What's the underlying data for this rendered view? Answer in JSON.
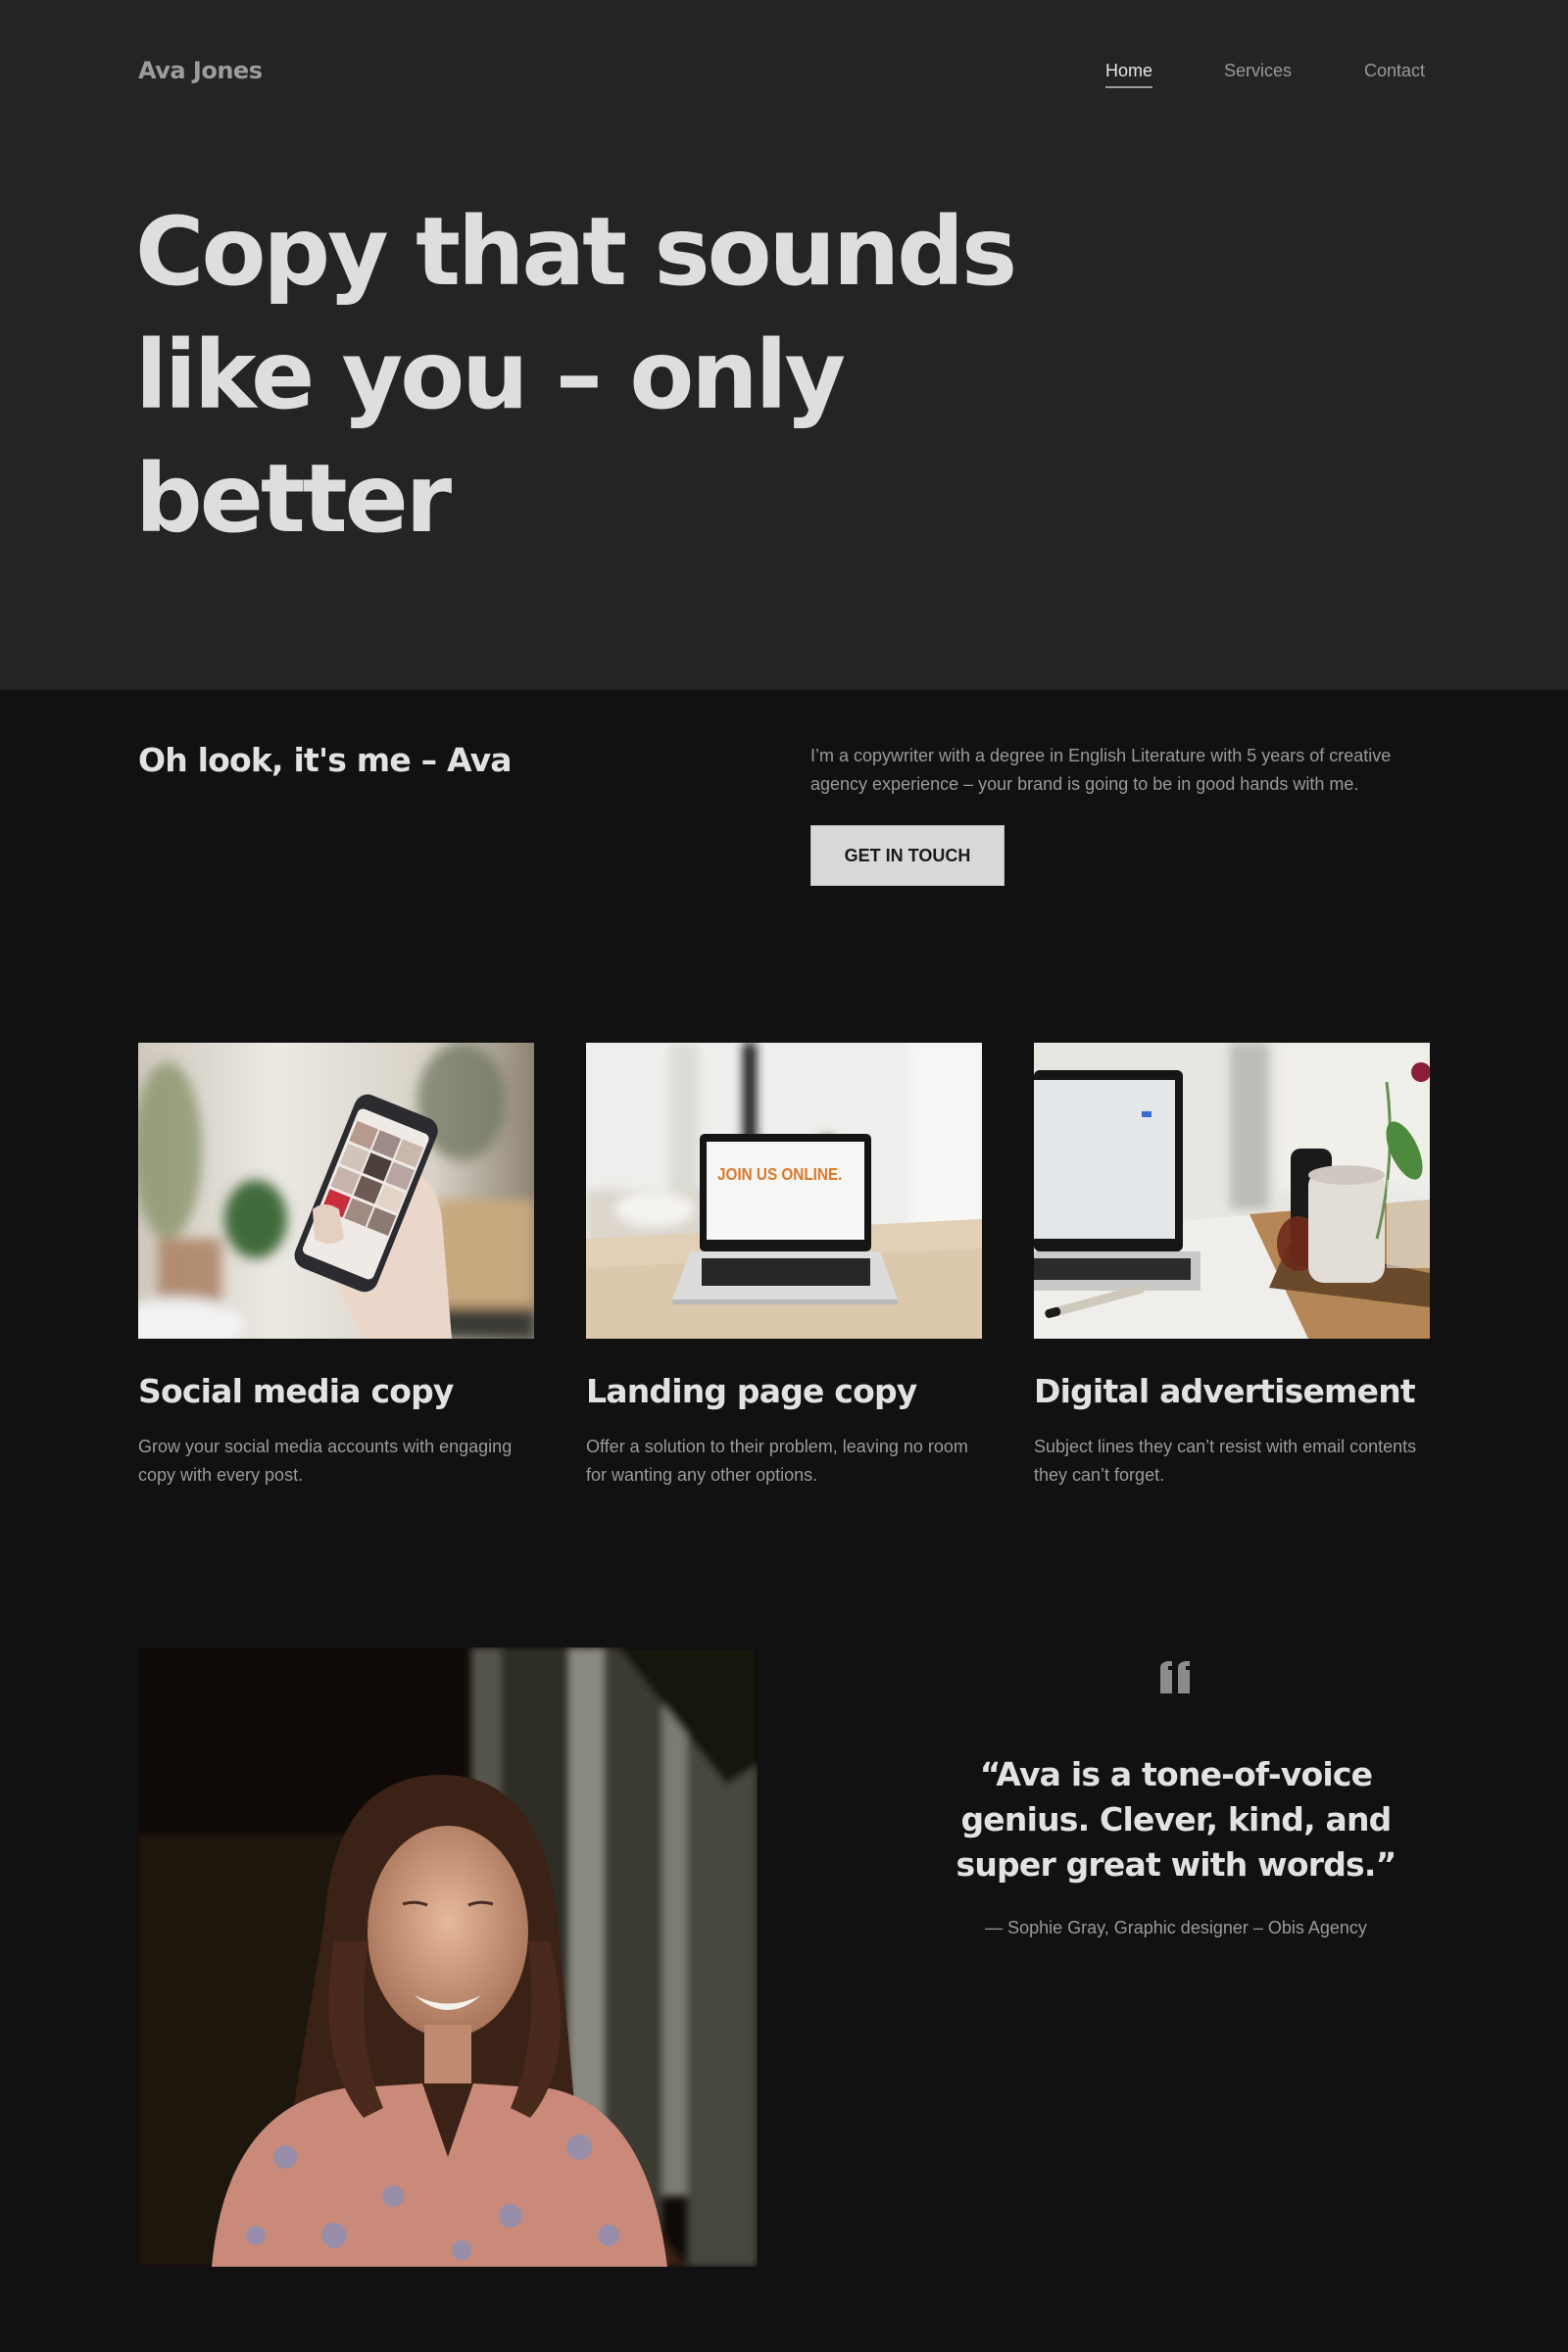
{
  "header": {
    "logo": "Ava Jones",
    "nav": [
      {
        "label": "Home",
        "active": true
      },
      {
        "label": "Services",
        "active": false
      },
      {
        "label": "Contact",
        "active": false
      }
    ],
    "hero_title": "Copy that sounds like you – only better"
  },
  "intro": {
    "heading": "Oh look, it's me – Ava",
    "text": "I’m a copywriter with a degree in English Literature with 5 years of creative agency experience – your brand is going to be in good hands with me.",
    "cta_label": "GET IN TOUCH"
  },
  "services": [
    {
      "title": "Social media copy",
      "description": "Grow your social media accounts with engaging copy with every post.",
      "image": "hand-holding-smartphone-photo"
    },
    {
      "title": "Landing page copy",
      "description": "Offer a solution to their problem, leaving no room for wanting any other options.",
      "image": "laptop-join-us-online-photo",
      "screen_text": "JOIN US ONLINE."
    },
    {
      "title": "Digital advertisement",
      "description": "Subject lines they can’t resist with email contents they can’t forget.",
      "image": "laptop-desk-mug-photo"
    }
  ],
  "testimonial": {
    "image": "smiling-woman-portrait-photo",
    "icon": "quote-icon",
    "quote": "“Ava is a tone-of-voice genius. Clever, kind, and super great with words.”",
    "author": "— Sophie Gray, Graphic designer – Obis Agency"
  },
  "colors": {
    "header_bg": "#242424",
    "page_bg": "#111111",
    "button_bg": "#d9d9d9",
    "muted_text": "#9a9a9a",
    "heading_text": "#e2e2e2"
  }
}
